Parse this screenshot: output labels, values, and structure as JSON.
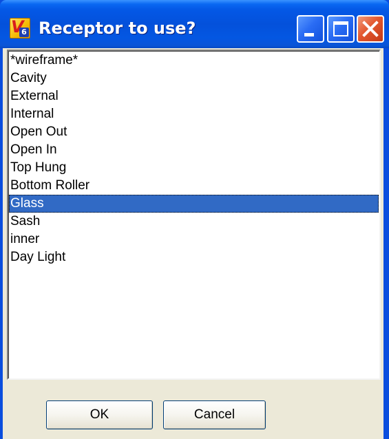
{
  "window": {
    "title": "Receptor to use?",
    "icon": "v6-app-icon",
    "icon_letter": "V",
    "icon_number": "6",
    "caption_buttons": [
      "minimize-icon",
      "maximize-icon",
      "close-icon"
    ]
  },
  "list": {
    "items": [
      "*wireframe*",
      "Cavity",
      "External",
      "Internal",
      "Open Out",
      "Open In",
      "Top Hung",
      "Bottom Roller",
      "Glass",
      "Sash",
      "inner",
      "Day Light"
    ],
    "selected": "Glass"
  },
  "buttons": {
    "ok_label": "OK",
    "cancel_label": "Cancel"
  },
  "colors": {
    "titlebar": "#0451db",
    "selection": "#316ac5",
    "dialog_face": "#ece9d8",
    "close_button": "#e3582f"
  }
}
